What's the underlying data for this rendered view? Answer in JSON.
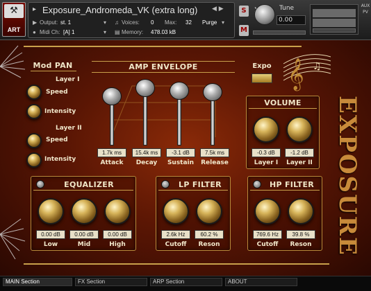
{
  "header": {
    "art_label": "ART",
    "instrument_name": "Exposure_Andromeda_VK (extra long)",
    "output_label": "Output:",
    "output_value": "st. 1",
    "voices_label": "Voices:",
    "voices_value": "0",
    "max_label": "Max:",
    "max_value": "32",
    "purge_label": "Purge",
    "midi_label": "Midi Ch:",
    "midi_value": "[A]  1",
    "memory_label": "Memory:",
    "memory_value": "478.03 kB",
    "s_label": "S",
    "m_label": "M",
    "tune_label": "Tune",
    "tune_value": "0.00",
    "aux_label": "AUX",
    "pv_label": "PV"
  },
  "mod_pan": {
    "title": "Mod PAN",
    "layer1": "Layer I",
    "layer2": "Layer II",
    "speed1": "Speed",
    "intensity1": "Intensity",
    "speed2": "Speed",
    "intensity2": "Intensity"
  },
  "amp_envelope": {
    "title": "AMP  ENVELOPE",
    "attack_value": "1.7k ms",
    "decay_value": "15.4k ms",
    "sustain_value": "-3.1 dB",
    "release_value": "7.5k ms",
    "attack_label": "Attack",
    "decay_label": "Decay",
    "sustain_label": "Sustain",
    "release_label": "Release"
  },
  "expo": {
    "label": "Expo"
  },
  "volume": {
    "title": "VOLUME",
    "layer1_value": "-0.3 dB",
    "layer2_value": "-1.2 dB",
    "layer1_label": "Layer I",
    "layer2_label": "Layer II"
  },
  "equalizer": {
    "title": "EQUALIZER",
    "low_value": "0.00 dB",
    "mid_value": "0.00 dB",
    "high_value": "0.00 dB",
    "low_label": "Low",
    "mid_label": "Mid",
    "high_label": "High"
  },
  "lp_filter": {
    "title": "LP  FILTER",
    "cutoff_value": "2.6k Hz",
    "reson_value": "60.2 %",
    "cutoff_label": "Cutoff",
    "reson_label": "Reson"
  },
  "hp_filter": {
    "title": "HP  FILTER",
    "cutoff_value": "769.6 Hz",
    "reson_value": "39.8 %",
    "cutoff_label": "Cutoff",
    "reson_label": "Reson"
  },
  "brand": {
    "word": "EXPOSURE"
  },
  "footer": {
    "tabs": [
      "MAIN Section",
      "FX Section",
      "ARP Section",
      "ABOUT"
    ]
  },
  "colors": {
    "gold": "#c9a14b",
    "panel_red": "#6a1a06"
  }
}
